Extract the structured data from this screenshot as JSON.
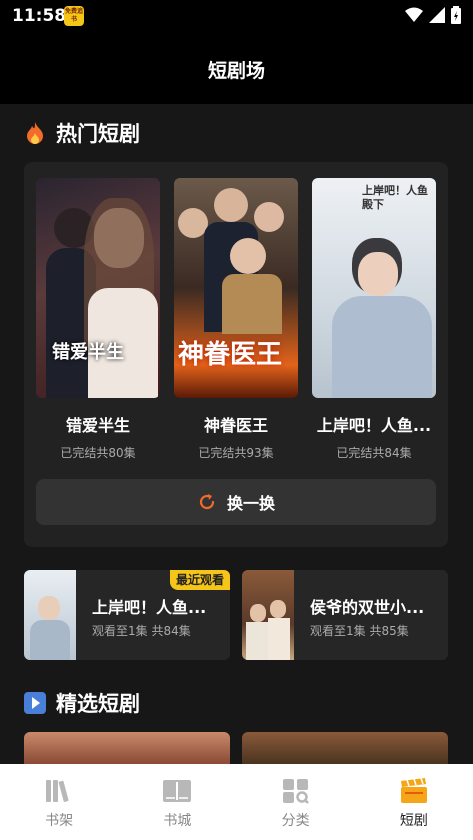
{
  "status_bar": {
    "time": "11:58",
    "badge_text": "免费追书"
  },
  "header": {
    "title": "短剧场"
  },
  "hot_section": {
    "title": "热门短剧",
    "items": [
      {
        "title": "错爱半生",
        "subtitle": "已完结共80集",
        "poster_text": "错爱半生"
      },
      {
        "title": "神眷医王",
        "subtitle": "已完结共93集",
        "poster_text": "神眷医王"
      },
      {
        "title": "上岸吧！人鱼...",
        "subtitle": "已完结共84集",
        "poster_text": "上岸吧！人鱼殿下"
      }
    ],
    "refresh_label": "换一换"
  },
  "recent": [
    {
      "title": "上岸吧！人鱼...",
      "subtitle": "观看至1集 共84集",
      "badge": "最近观看"
    },
    {
      "title": "侯爷的双世小...",
      "subtitle": "观看至1集 共85集"
    }
  ],
  "featured_section": {
    "title": "精选短剧"
  },
  "tabs": [
    {
      "label": "书架",
      "icon": "bookshelf-icon"
    },
    {
      "label": "书城",
      "icon": "book-open-icon"
    },
    {
      "label": "分类",
      "icon": "category-grid-icon"
    },
    {
      "label": "短剧",
      "icon": "clapperboard-icon",
      "active": true
    }
  ],
  "colors": {
    "accent": "#f5c518",
    "refresh_icon": "#f26b2a",
    "fire": "#f26b2a"
  }
}
